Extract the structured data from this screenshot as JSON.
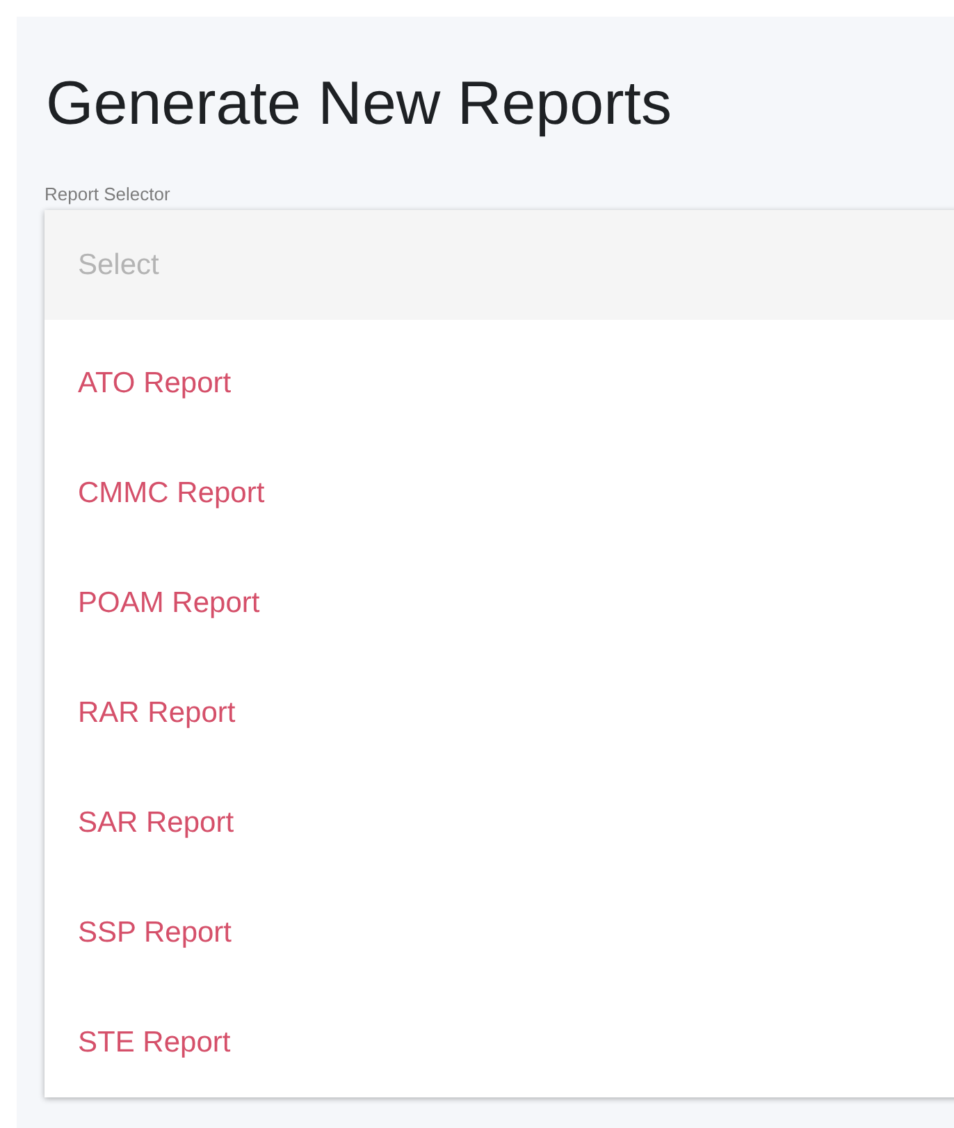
{
  "title": "Generate New Reports",
  "report_selector": {
    "label": "Report Selector",
    "placeholder": "Select",
    "options": [
      {
        "label": "ATO Report"
      },
      {
        "label": "CMMC Report"
      },
      {
        "label": "POAM Report"
      },
      {
        "label": "RAR Report"
      },
      {
        "label": "SAR Report"
      },
      {
        "label": "SSP Report"
      },
      {
        "label": "STE Report"
      }
    ]
  }
}
